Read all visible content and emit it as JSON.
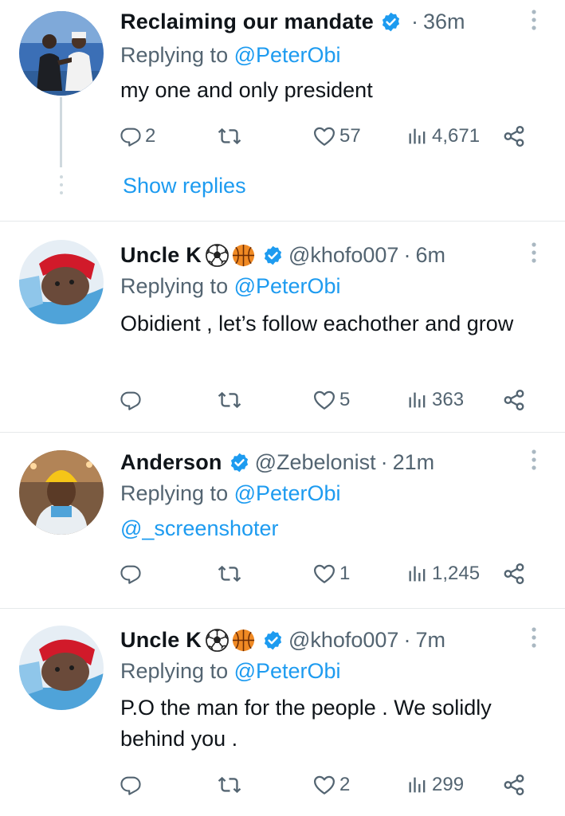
{
  "tweets": [
    {
      "name": "Reclaiming our mandate",
      "handle": "",
      "time": "36m",
      "replying_prefix": "Replying to ",
      "replying_to": "@PeterObi",
      "text": "my one and only president",
      "replies": "2",
      "likes": "57",
      "views": "4,671",
      "verified": true,
      "show_replies": "Show replies"
    },
    {
      "name": "Uncle K",
      "handle": "@khofo007",
      "time": "6m",
      "replying_prefix": "Replying to ",
      "replying_to": "@PeterObi",
      "text": "Obidient , let’s follow eachother and grow",
      "replies": "",
      "likes": "5",
      "views": "363",
      "verified": true
    },
    {
      "name": "Anderson",
      "handle": "@Zebelonist",
      "time": "21m",
      "replying_prefix": "Replying to ",
      "replying_to": "@PeterObi",
      "text": "@_screenshoter",
      "replies": "",
      "likes": "1",
      "views": "1,245",
      "verified": true
    },
    {
      "name": "Uncle K",
      "handle": "@khofo007",
      "time": "7m",
      "replying_prefix": "Replying to ",
      "replying_to": "@PeterObi",
      "text": "P.O the man for the people . We solidly behind you .",
      "replies": "",
      "likes": "2",
      "views": "299",
      "verified": true
    }
  ],
  "colors": {
    "text": "#0f1419",
    "secondary": "#536471",
    "link": "#1d9bf0",
    "verified": "#1d9bf0",
    "divider": "#e6e9eb"
  },
  "icons": [
    "verified-badge-icon",
    "soccer-ball-icon",
    "basketball-icon",
    "more-icon",
    "reply-icon",
    "retweet-icon",
    "like-icon",
    "views-icon",
    "share-icon"
  ]
}
